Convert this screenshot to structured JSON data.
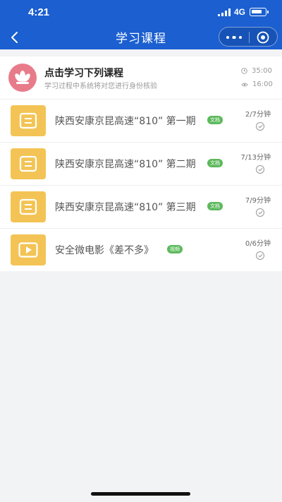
{
  "status_bar": {
    "time": "4:21",
    "network": "4G"
  },
  "nav": {
    "title": "学习课程",
    "back_icon": "chevron-left-icon",
    "more_icon": "more-dots-icon",
    "close_icon": "target-circle-icon"
  },
  "header": {
    "icon": "lotus-icon",
    "title": "点击学习下列课程",
    "subtitle": "学习过程中系统将对您进行身份核验",
    "stats": [
      {
        "icon": "clock-icon",
        "value": "35:00"
      },
      {
        "icon": "eye-icon",
        "value": "16:00"
      }
    ]
  },
  "courses": [
    {
      "icon": "document-icon",
      "title": "陕西安康京昆高速“810” 第一期",
      "badge": "文档",
      "duration": "2/7分钟"
    },
    {
      "icon": "document-icon",
      "title": "陕西安康京昆高速“810” 第二期",
      "badge": "文档",
      "duration": "7/13分钟"
    },
    {
      "icon": "document-icon",
      "title": "陕西安康京昆高速“810” 第三期",
      "badge": "文档",
      "duration": "7/9分钟"
    },
    {
      "icon": "play-icon",
      "title": "安全微电影《差不多》",
      "badge": "视频",
      "duration": "0/6分钟"
    }
  ],
  "colors": {
    "primary": "#1b5fd0",
    "thumb": "#f3c455",
    "badge": "#5cb95c",
    "avatar": "#e87b8a"
  }
}
